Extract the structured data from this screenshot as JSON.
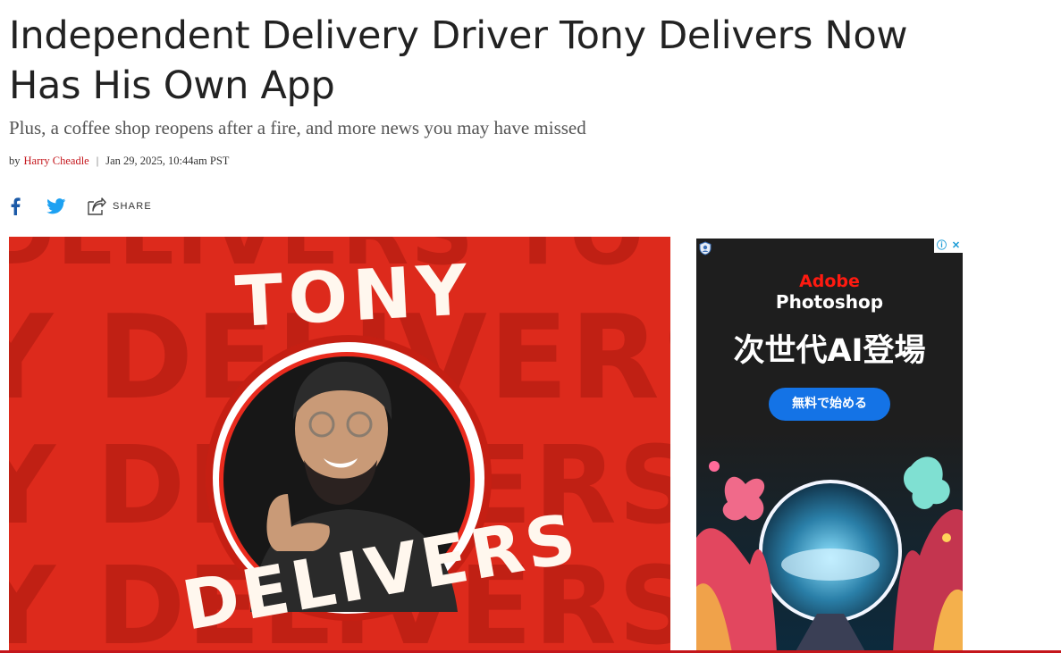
{
  "article": {
    "headline": "Independent Delivery Driver Tony Delivers Now Has His Own App",
    "dek": "Plus, a coffee shop reopens after a fire, and more news you may have missed",
    "byline_prefix": "by",
    "author": "Harry Cheadle",
    "separator": "|",
    "date": "Jan 29, 2025, 10:44am PST"
  },
  "share": {
    "facebook_icon": "facebook-icon",
    "twitter_icon": "twitter-icon",
    "share_label": "SHARE"
  },
  "hero": {
    "title_top": "TONY",
    "title_bottom": "DELIVERS",
    "background_words": [
      "DELIVERS TO",
      "Y DELIVERS TO",
      "Y DELIVERS TO",
      "Y DELIVERS"
    ],
    "colors": {
      "background": "#dd2a1c",
      "text": "#fff7ee"
    }
  },
  "ad": {
    "brand": "Adobe",
    "product": "Photoshop",
    "headline": "次世代AI登場",
    "cta": "無料で始める",
    "adchoices_icon": "adchoices-icon",
    "close_icon": "close-icon",
    "colors": {
      "brand": "#ff1a10",
      "cta": "#1473e6"
    }
  },
  "colors": {
    "accent": "#c4161c",
    "facebook": "#1b5aa8",
    "twitter": "#1da1f2"
  }
}
